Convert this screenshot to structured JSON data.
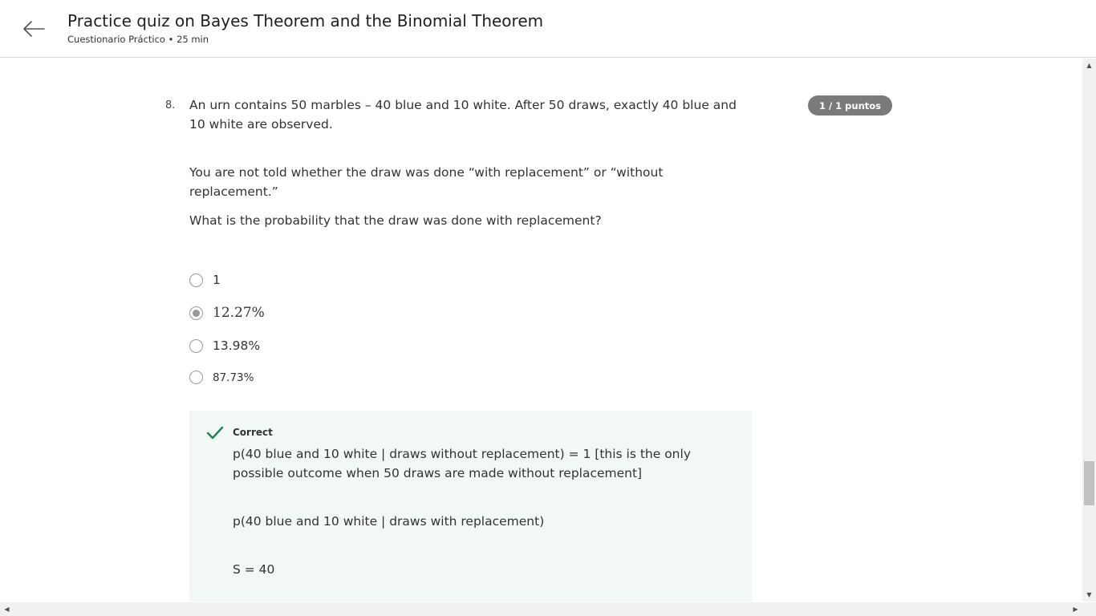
{
  "header": {
    "title": "Practice quiz on Bayes Theorem and the Binomial Theorem",
    "subtitle": "Cuestionario Práctico • 25 min",
    "back_icon": "arrow-left-icon"
  },
  "question": {
    "number": "8.",
    "points": "1 / 1 puntos",
    "paragraphs": [
      "An urn contains 50 marbles – 40 blue and 10 white. After 50 draws, exactly 40 blue and 10 white are observed.",
      "You are not told whether the draw was done “with replacement” or “without replacement.”",
      "What is the probability that the draw was done with replacement?"
    ],
    "options": [
      {
        "label": "1",
        "selected": false
      },
      {
        "label": "12.27%",
        "selected": true
      },
      {
        "label": "13.98%",
        "selected": false
      },
      {
        "label": "87.73%",
        "selected": false
      }
    ]
  },
  "feedback": {
    "status": "Correct",
    "icon": "checkmark-icon",
    "accent_color": "#1f8354",
    "paragraphs": [
      "p(40 blue and 10 white | draws without replacement) = 1 [this is the only possible outcome when 50 draws are made without replacement]",
      "p(40 blue and 10 white | draws with replacement)",
      "S = 40"
    ]
  },
  "scrollbar": {
    "up_glyph": "▲",
    "down_glyph": "▼",
    "left_glyph": "◀",
    "right_glyph": "▶"
  }
}
